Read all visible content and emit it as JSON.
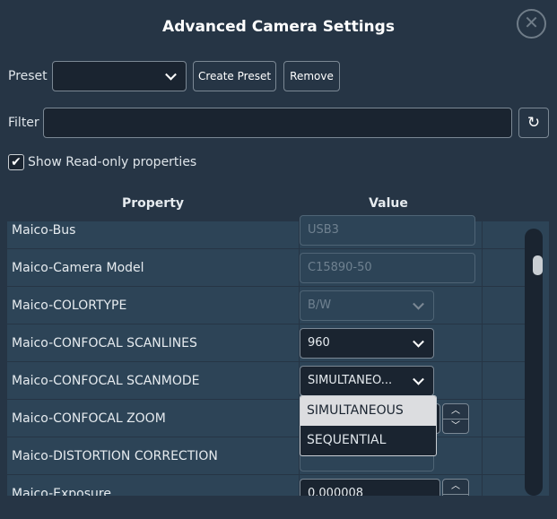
{
  "title": "Advanced Camera Settings",
  "preset": {
    "label": "Preset",
    "value": "",
    "create_label": "Create Preset",
    "remove_label": "Remove"
  },
  "filter": {
    "label": "Filter",
    "value": ""
  },
  "show_readonly": {
    "label": "Show Read-only properties",
    "checked": true
  },
  "table": {
    "headers": [
      "Property",
      "Value"
    ],
    "rows": [
      {
        "name": "Maico-Bus",
        "value": "USB3"
      },
      {
        "name": "Maico-Camera Model",
        "value": "C15890-50"
      },
      {
        "name": "Maico-COLORTYPE",
        "value": "B/W"
      },
      {
        "name": "Maico-CONFOCAL SCANLINES",
        "value": "960"
      },
      {
        "name": "Maico-CONFOCAL SCANMODE",
        "value": "SIMULTANEO..."
      },
      {
        "name": "Maico-CONFOCAL ZOOM",
        "value": ""
      },
      {
        "name": "Maico-DISTORTION CORRECTION",
        "value": ""
      },
      {
        "name": "Maico-Exposure",
        "value": "0.000008"
      }
    ]
  },
  "dropdown_options": [
    "SIMULTANEOUS",
    "SEQUENTIAL"
  ],
  "icons": {
    "close": "close-circle-icon",
    "refresh": "refresh-icon"
  }
}
